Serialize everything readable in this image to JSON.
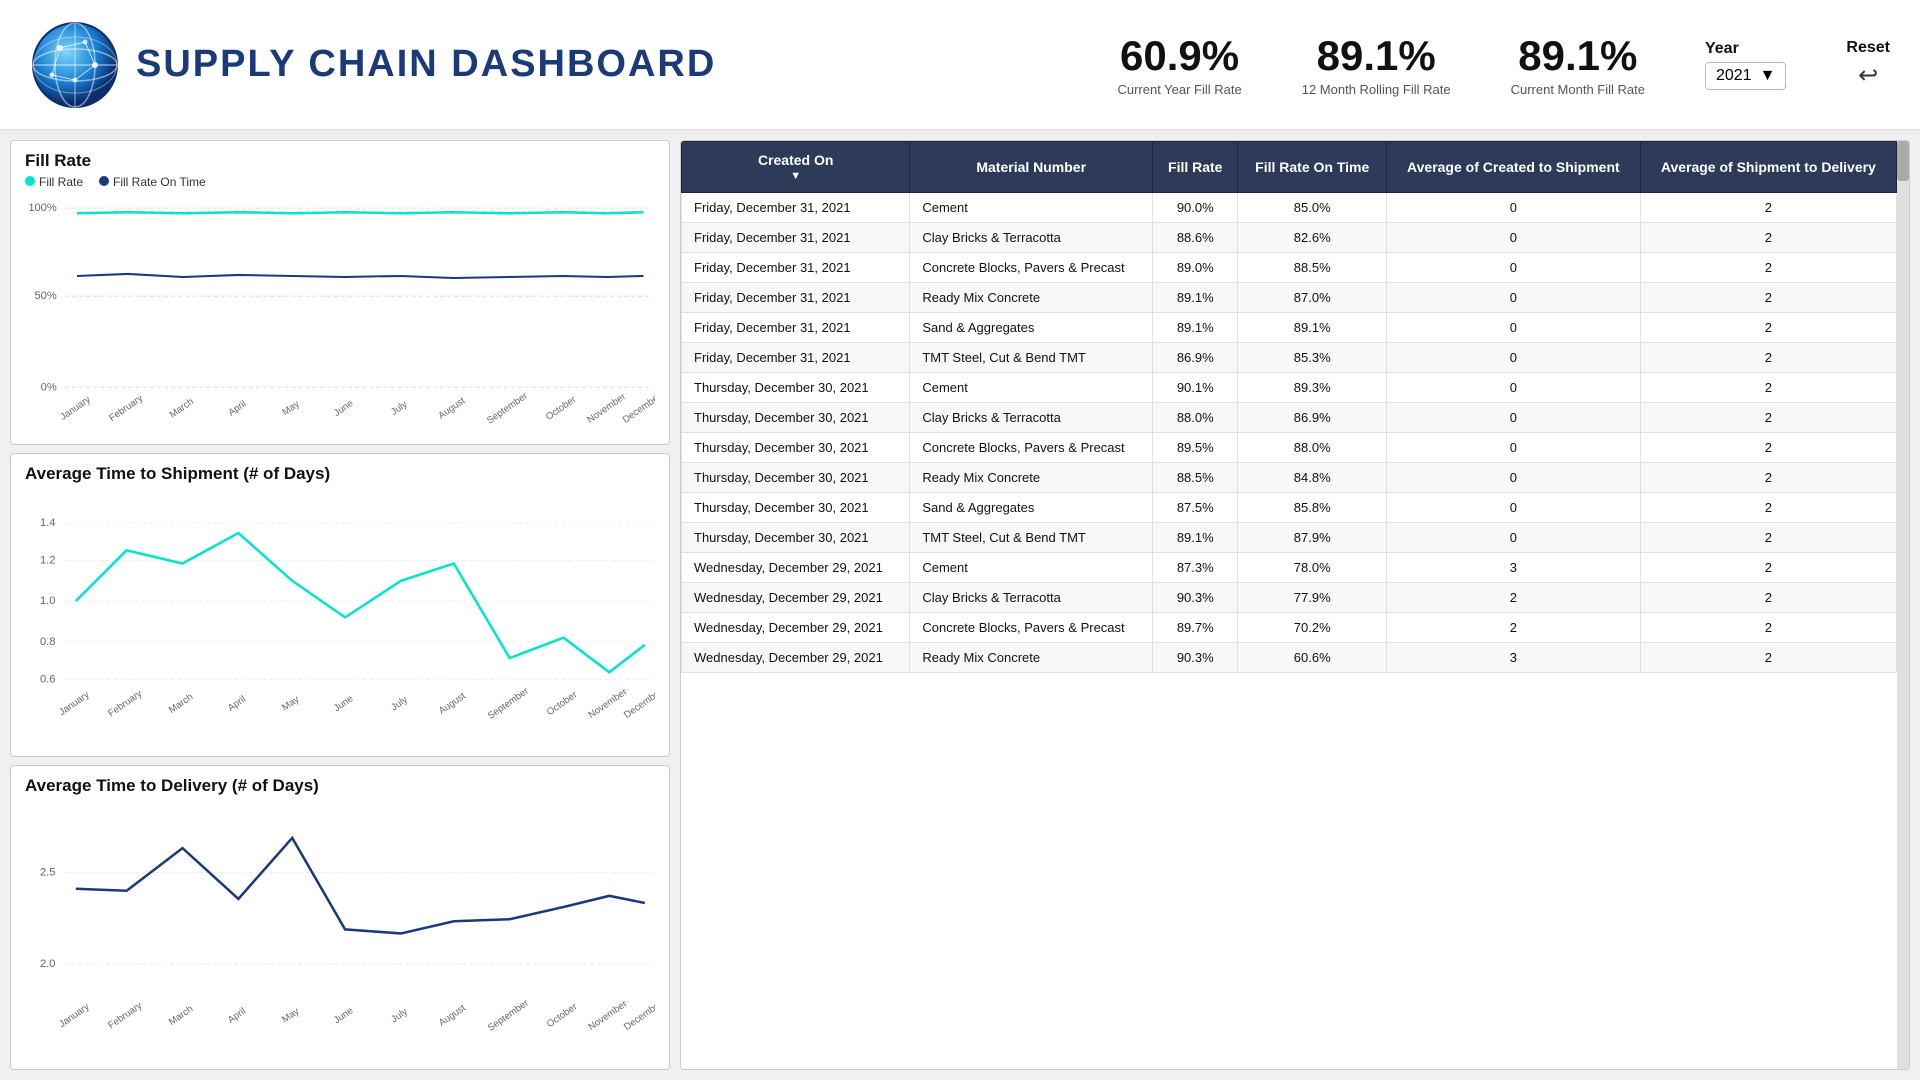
{
  "header": {
    "title": "SUPPLY CHAIN DASHBOARD",
    "metrics": [
      {
        "value": "60.9%",
        "label": "Current Year Fill Rate"
      },
      {
        "value": "89.1%",
        "label": "12 Month Rolling Fill Rate"
      },
      {
        "value": "89.1%",
        "label": "Current Month Fill Rate"
      }
    ],
    "year_label": "Year",
    "year_value": "2021",
    "reset_label": "Reset"
  },
  "charts": {
    "fill_rate": {
      "title": "Fill Rate",
      "legend": [
        {
          "label": "Fill Rate",
          "color": "#00e5cc"
        },
        {
          "label": "Fill Rate On Time",
          "color": "#1a3a7a"
        }
      ],
      "y_labels": [
        "100%",
        "50%",
        "0%"
      ],
      "x_labels": [
        "January",
        "February",
        "March",
        "April",
        "May",
        "June",
        "July",
        "August",
        "September",
        "October",
        "November",
        "December"
      ]
    },
    "time_to_shipment": {
      "title": "Average Time to Shipment (# of Days)",
      "y_labels": [
        "1.4",
        "1.2",
        "1.0",
        "0.8",
        "0.6"
      ],
      "x_labels": [
        "January",
        "February",
        "March",
        "April",
        "May",
        "June",
        "July",
        "August",
        "September",
        "October",
        "November",
        "December"
      ]
    },
    "time_to_delivery": {
      "title": "Average Time to Delivery (# of Days)",
      "y_labels": [
        "2.5",
        "2.0"
      ],
      "x_labels": [
        "January",
        "February",
        "March",
        "April",
        "May",
        "June",
        "July",
        "August",
        "September",
        "October",
        "November",
        "December"
      ]
    }
  },
  "table": {
    "columns": [
      "Created On",
      "Material Number",
      "Fill Rate",
      "Fill Rate On Time",
      "Average of Created to Shipment",
      "Average of Shipment to Delivery"
    ],
    "rows": [
      [
        "Friday, December 31, 2021",
        "Cement",
        "90.0%",
        "85.0%",
        "0",
        "2"
      ],
      [
        "Friday, December 31, 2021",
        "Clay Bricks & Terracotta",
        "88.6%",
        "82.6%",
        "0",
        "2"
      ],
      [
        "Friday, December 31, 2021",
        "Concrete Blocks, Pavers & Precast",
        "89.0%",
        "88.5%",
        "0",
        "2"
      ],
      [
        "Friday, December 31, 2021",
        "Ready Mix Concrete",
        "89.1%",
        "87.0%",
        "0",
        "2"
      ],
      [
        "Friday, December 31, 2021",
        "Sand & Aggregates",
        "89.1%",
        "89.1%",
        "0",
        "2"
      ],
      [
        "Friday, December 31, 2021",
        "TMT Steel, Cut & Bend TMT",
        "86.9%",
        "85.3%",
        "0",
        "2"
      ],
      [
        "Thursday, December 30, 2021",
        "Cement",
        "90.1%",
        "89.3%",
        "0",
        "2"
      ],
      [
        "Thursday, December 30, 2021",
        "Clay Bricks & Terracotta",
        "88.0%",
        "86.9%",
        "0",
        "2"
      ],
      [
        "Thursday, December 30, 2021",
        "Concrete Blocks, Pavers & Precast",
        "89.5%",
        "88.0%",
        "0",
        "2"
      ],
      [
        "Thursday, December 30, 2021",
        "Ready Mix Concrete",
        "88.5%",
        "84.8%",
        "0",
        "2"
      ],
      [
        "Thursday, December 30, 2021",
        "Sand & Aggregates",
        "87.5%",
        "85.8%",
        "0",
        "2"
      ],
      [
        "Thursday, December 30, 2021",
        "TMT Steel, Cut & Bend TMT",
        "89.1%",
        "87.9%",
        "0",
        "2"
      ],
      [
        "Wednesday, December 29, 2021",
        "Cement",
        "87.3%",
        "78.0%",
        "3",
        "2"
      ],
      [
        "Wednesday, December 29, 2021",
        "Clay Bricks & Terracotta",
        "90.3%",
        "77.9%",
        "2",
        "2"
      ],
      [
        "Wednesday, December 29, 2021",
        "Concrete Blocks, Pavers & Precast",
        "89.7%",
        "70.2%",
        "2",
        "2"
      ],
      [
        "Wednesday, December 29, 2021",
        "Ready Mix Concrete",
        "90.3%",
        "60.6%",
        "3",
        "2"
      ]
    ]
  }
}
